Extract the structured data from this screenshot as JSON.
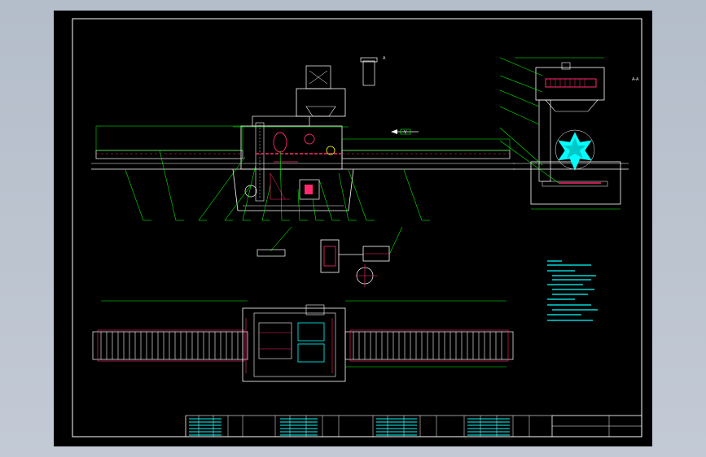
{
  "drawing": {
    "section_tag": "A-A",
    "elevation_tag": "A",
    "flow_label": "V"
  },
  "colors": {
    "background": "#000000",
    "border": "#ffffff",
    "structure": "#ffffff",
    "dimension": "#00ff00",
    "highlight": "#ff2a6d",
    "accent": "#00ffff",
    "hidden": "#ff4040",
    "yellow": "#ffff00"
  },
  "callouts": {
    "elevation_count": 14,
    "side_count": 6
  }
}
